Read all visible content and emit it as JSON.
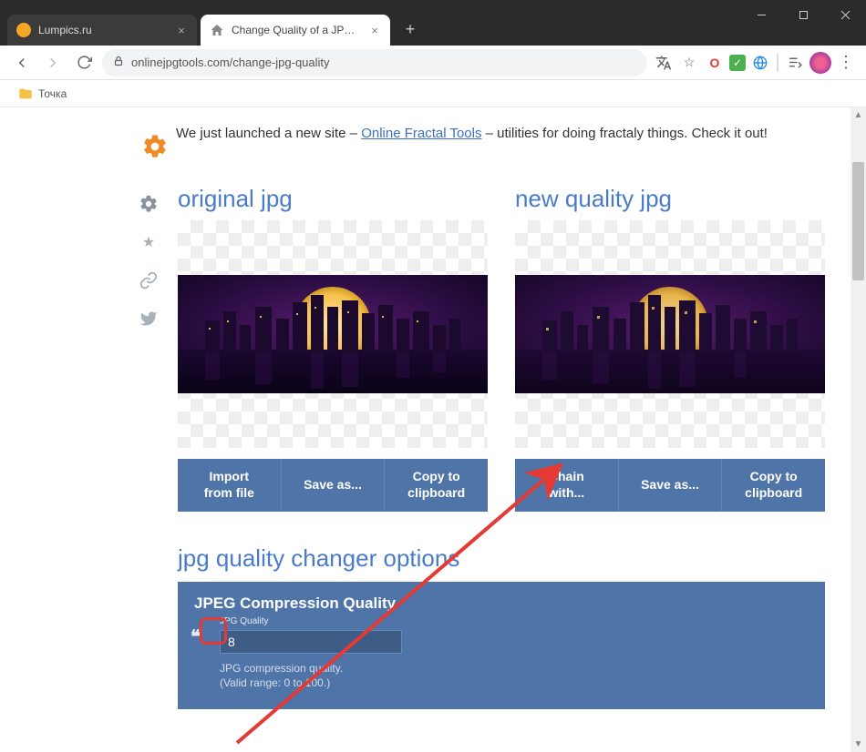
{
  "window": {
    "tabs": [
      {
        "title": "Lumpics.ru",
        "favicon_color": "#f5a623",
        "active": false
      },
      {
        "title": "Change Quality of a JPEG - Onlin",
        "favicon_color": "#888",
        "active": true
      }
    ],
    "controls": {
      "minimize": "minimize",
      "maximize": "maximize",
      "close": "close"
    }
  },
  "toolbar": {
    "url_display": "onlinejpgtools.com/change-jpg-quality",
    "bookmarks_bar": [
      {
        "label": "Точка",
        "type": "folder"
      }
    ]
  },
  "extensions": {
    "translate": "translate-icon",
    "star": "star-icon",
    "opera": "O",
    "check": "✓",
    "globe": "globe",
    "playlist": "playlist-icon",
    "avatar": "avatar",
    "menu": "menu-dots"
  },
  "page": {
    "banner": {
      "pre": "We just launched a new site – ",
      "link": "Online Fractal Tools",
      "post": " – utilities for doing fractaly things. Check it out!"
    },
    "left": {
      "heading": "original jpg",
      "buttons": {
        "import": "Import\nfrom file",
        "save": "Save as...",
        "copy": "Copy to\nclipboard"
      }
    },
    "right": {
      "heading": "new quality jpg",
      "buttons": {
        "chain": "Chain\nwith...",
        "save": "Save as...",
        "copy": "Copy to\nclipboard"
      }
    },
    "options": {
      "heading": "jpg quality changer options",
      "section_title": "JPEG Compression Quality",
      "field_label": "JPG Quality",
      "value": "8",
      "desc1": "JPG compression quality.",
      "desc2": "(Valid range: 0 to 100.)"
    }
  }
}
